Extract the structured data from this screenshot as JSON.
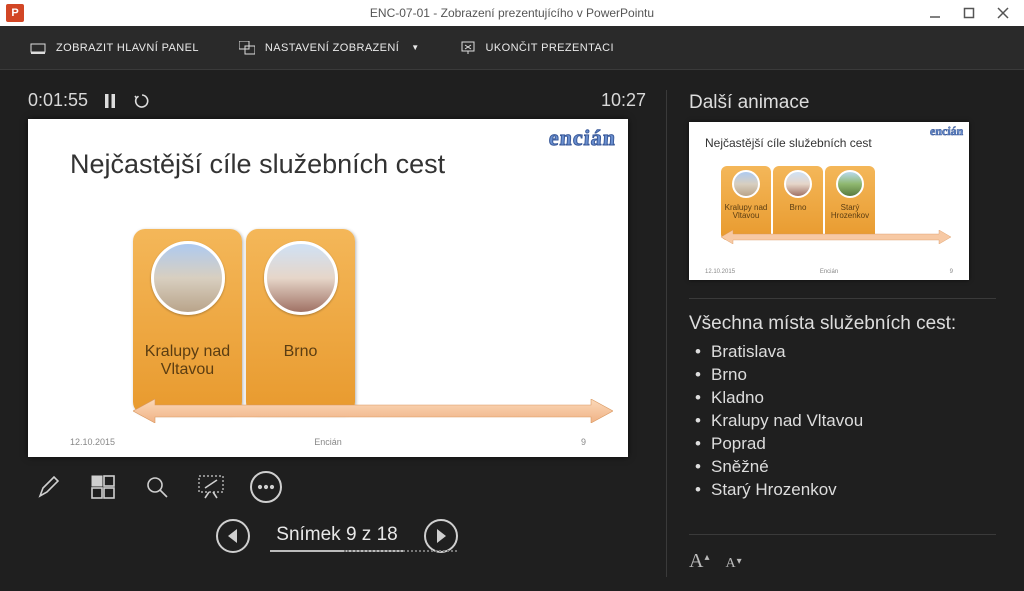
{
  "app": {
    "window_title": "ENC-07-01 - Zobrazení prezentujícího v PowerPointu"
  },
  "commands": {
    "show_taskbar": "ZOBRAZIT HLAVNÍ PANEL",
    "display_settings": "NASTAVENÍ ZOBRAZENÍ",
    "end_show": "UKONČIT PREZENTACI"
  },
  "timer": {
    "elapsed": "0:01:55",
    "clock": "10:27"
  },
  "slide": {
    "logo": "encián",
    "title": "Nejčastější cíle služebních cest",
    "cards": [
      {
        "label": "Kralupy nad\nVltavou"
      },
      {
        "label": "Brno"
      }
    ],
    "footer_left": "12.10.2015",
    "footer_center": "Encián",
    "footer_right": "9"
  },
  "nav": {
    "label": "Snímek 9 z 18"
  },
  "right": {
    "next_heading": "Další animace",
    "preview": {
      "title": "Nejčastější cíle služebních cest",
      "cards": [
        {
          "label": "Kralupy nad\nVltavou"
        },
        {
          "label": "Brno"
        },
        {
          "label": "Starý\nHrozenkov"
        }
      ]
    },
    "notes_title": "Všechna místa služebních cest:",
    "notes_items": [
      "Bratislava",
      "Brno",
      "Kladno",
      "Kralupy nad Vltavou",
      "Poprad",
      "Sněžné",
      "Starý Hrozenkov"
    ]
  }
}
